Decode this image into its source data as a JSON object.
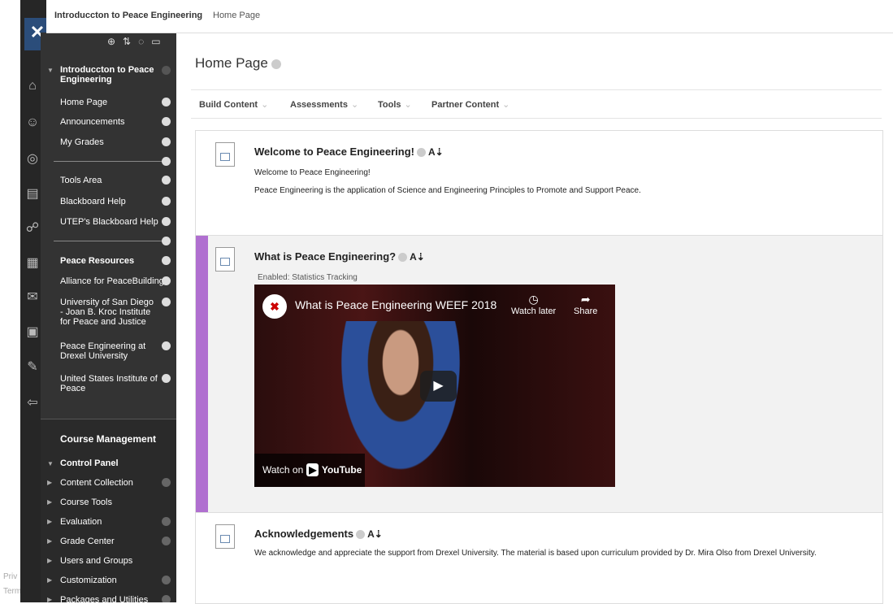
{
  "footer": {
    "privacy": "Priv",
    "terms": "Term"
  },
  "topbar": {
    "course": "Introduccton to Peace Engineering",
    "page": "Home Page"
  },
  "menu": {
    "course_title": "Introduccton to Peace Engineering",
    "items": [
      {
        "label": "Home Page"
      },
      {
        "label": "Announcements"
      },
      {
        "label": "My Grades"
      },
      {
        "label": "Tools Area"
      },
      {
        "label": "Blackboard Help"
      },
      {
        "label": "UTEP's Blackboard Help"
      },
      {
        "label": "Peace Resources"
      },
      {
        "label": "Alliance for PeaceBuilding"
      },
      {
        "label": "University of San Diego - Joan B. Kroc Institute for Peace and Justice"
      },
      {
        "label": "Peace Engineering at Drexel University"
      },
      {
        "label": "United States Institute of Peace"
      }
    ],
    "management_title": "Course Management",
    "control_panel": "Control Panel",
    "cp_items": [
      {
        "label": "Content Collection"
      },
      {
        "label": "Course Tools"
      },
      {
        "label": "Evaluation"
      },
      {
        "label": "Grade Center"
      },
      {
        "label": "Users and Groups"
      },
      {
        "label": "Customization"
      },
      {
        "label": "Packages and Utilities"
      }
    ]
  },
  "page": {
    "title": "Home Page"
  },
  "toolbar": {
    "build": "Build Content",
    "assessments": "Assessments",
    "tools": "Tools",
    "partner": "Partner Content"
  },
  "items": [
    {
      "title": "Welcome to Peace Engineering!",
      "line1": "Welcome to Peace Engineering!",
      "line2": "Peace Engineering is the application of Science and Engineering Principles to Promote and Support Peace."
    },
    {
      "title": "What is Peace Engineering?",
      "enabled": "Enabled:  Statistics Tracking",
      "video_title": "What is Peace Engineering WEEF 2018",
      "watch_later": "Watch later",
      "share": "Share",
      "watch_on": "Watch on",
      "youtube": "YouTube"
    },
    {
      "title": "Acknowledgements",
      "line1": "We acknowledge and appreciate the support from Drexel University.  The material is based upon curriculum provided by Dr. Mira Olso from Drexel University."
    }
  ]
}
